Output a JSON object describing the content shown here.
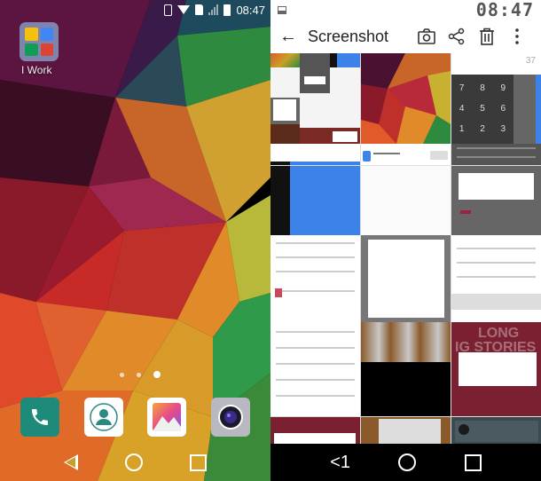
{
  "left_screen": {
    "status_bar": {
      "time": "08:47",
      "icons": [
        "vibrate-icon",
        "wifi-icon",
        "no-sim-icon",
        "signal-icon",
        "battery-icon"
      ]
    },
    "folder": {
      "label": "I Work",
      "apps": [
        {
          "icon": "drive-icon",
          "color": "#f4c20d"
        },
        {
          "icon": "docs-icon",
          "color": "#4285f4"
        },
        {
          "icon": "sheets-icon",
          "color": "#0f9d58"
        },
        {
          "icon": "slides-icon",
          "color": "#db4437"
        }
      ]
    },
    "page_indicator": {
      "pages": 3,
      "active": 3
    },
    "dock": [
      {
        "name": "phone",
        "icon": "phone-icon",
        "color": "#1e8a7a"
      },
      {
        "name": "contacts",
        "icon": "contacts-icon",
        "color": "#ffffff"
      },
      {
        "name": "gallery",
        "icon": "gallery-icon",
        "color": "#ffffff"
      },
      {
        "name": "camera",
        "icon": "camera-icon",
        "color": "#b8b8c0"
      }
    ],
    "navbar": [
      "back",
      "home",
      "recent"
    ]
  },
  "right_screen": {
    "status_bar": {
      "time": "08:47",
      "indicator": "screenshot-indicator-icon"
    },
    "toolbar": {
      "back_icon": "←",
      "title": "Screenshot",
      "actions": [
        {
          "name": "camera",
          "icon": "camera-icon"
        },
        {
          "name": "share",
          "icon": "share-icon"
        },
        {
          "name": "delete",
          "icon": "trash-icon"
        },
        {
          "name": "more",
          "icon": "more-vert-icon"
        }
      ]
    },
    "thumbnails": {
      "calc_digits": [
        "7",
        "8",
        "9",
        "4",
        "5",
        "6",
        "1",
        "2",
        "3"
      ],
      "calc_display": "37",
      "watermark_long": "LONG",
      "watermark_ig": "IG STORIES"
    },
    "navbar": {
      "back_label": "<1"
    }
  }
}
